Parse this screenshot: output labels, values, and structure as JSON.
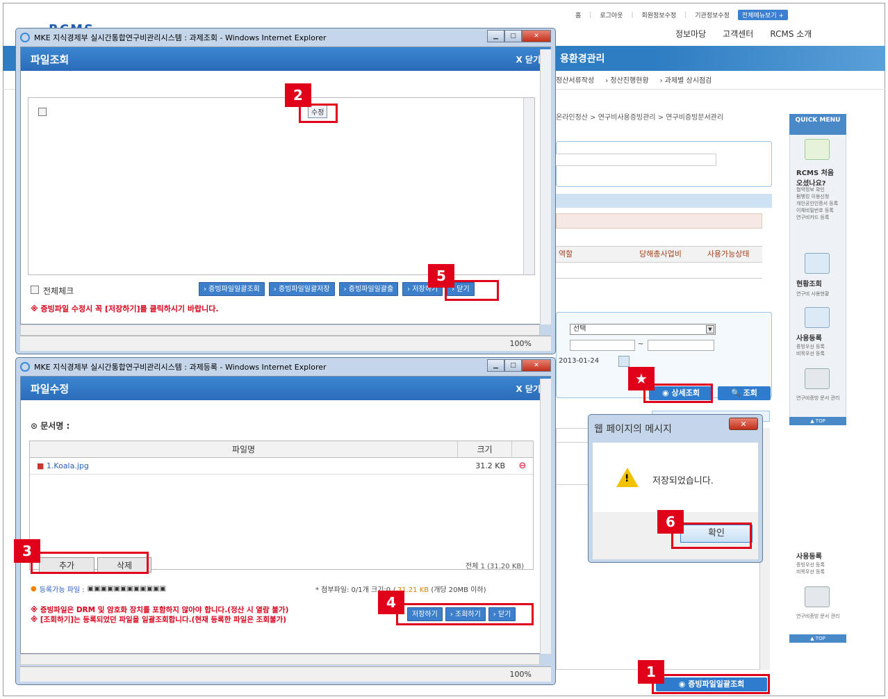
{
  "site": {
    "topnav": [
      "홈",
      "로그아웃",
      "회원정보수정",
      "기관정보수정"
    ],
    "allmenu": "전체메뉴보기 +",
    "topnav2": [
      "정보마당",
      "고객센터",
      "RCMS 소개"
    ],
    "section_title": "용환경관리",
    "submenu": [
      "정산서류작성",
      "› 정산진행현황",
      "› 과제별 상시점검"
    ],
    "breadcrumb": "온라인정산 > 연구비사용증빙관리 > 연구비증빙문서관리",
    "table_headers": [
      "역할",
      "당해총사업비",
      "사용가능상태"
    ],
    "select_value": "선택",
    "date_value": "2013-01-24",
    "detail_search": "상세조회",
    "search": "조회",
    "bulk_view": "증빙파일일괄조회"
  },
  "quick": {
    "head": "QUICK MENU",
    "items": [
      {
        "title": "RCMS 처음 오셨나요?",
        "sub": "협약정보 확인\n펌뱅킹 이용신청\n개인공인인증서 등록\n이체비밀번호 등록\n연구비카드 등록"
      },
      {
        "title": "현황조회",
        "sub": "연구비 사용현황"
      },
      {
        "title": "사용등록",
        "sub": "증빙우선 등록\n비목우선 등록"
      },
      {
        "title": "",
        "sub": "연구비증빙 문서 관리"
      }
    ],
    "top": "▲ TOP",
    "lower_title": "사용등록",
    "lower_sub": "증빙우선 등록\n비목우선 등록",
    "lower_sub2": "연구비증빙 문서 관리",
    "lower_top": "▲ TOP"
  },
  "win1": {
    "title": "MKE 지식경제부 실시간통합연구비관리시스템 : 과제조회 - Windows Internet Explorer",
    "pane_title": "파일조회",
    "close": "X 닫기",
    "edit_button": "수정",
    "check_all": "전체체크",
    "buttons": [
      "› 증빙파일일괄조회",
      "› 증빙파일일괄저장",
      "› 증빙파일일괄출",
      "› 저장하기",
      "› 닫기"
    ],
    "notice": "※ 증빙파일 수정시 꼭 [저장하기]를 클릭하시기 바랍니다.",
    "zoom": "100%"
  },
  "win2": {
    "title": "MKE 지식경제부 실시간통합연구비관리시스템 : 과제등록 - Windows Internet Explorer",
    "pane_title": "파일수정",
    "close": "X 닫기",
    "doc_label": "⊙ 문서명 :",
    "col_filename": "파일명",
    "col_size": "크기",
    "file_name": "1.Koala.jpg",
    "file_size": "31.2 KB",
    "add": "추가",
    "delete": "삭제",
    "total": "전체 1 (31.20 KB)",
    "allowed_label": "등록가능 파일 :",
    "attach_info": "* 첨부파일: 0/1개",
    "attach_size_prefix": "크기:0 /",
    "attach_size_limit": "31.21 KB",
    "attach_size_suffix": "(개당 20MB 이하)",
    "notice1": "※ 증빙파일은 DRM 및 암호화 장치를 포함하지 않아야 합니다.(정산 시 열람 불가)",
    "notice2": "※ [조회하기]는 등록되었던 파일을 일괄조회합니다.(현재 등록한 파일은 조회불가)",
    "save": "저장하기",
    "lookup": "› 조회하기",
    "close_btn": "› 닫기",
    "zoom": "100%"
  },
  "dialog": {
    "title": "웹 페이지의 메시지",
    "message": "저장되었습니다.",
    "ok": "확인"
  },
  "badges": [
    "1",
    "2",
    "3",
    "4",
    "5",
    "6",
    "★"
  ],
  "colors": {
    "accent_blue": "#2e7cc2",
    "annotation_red": "#e0001a"
  }
}
